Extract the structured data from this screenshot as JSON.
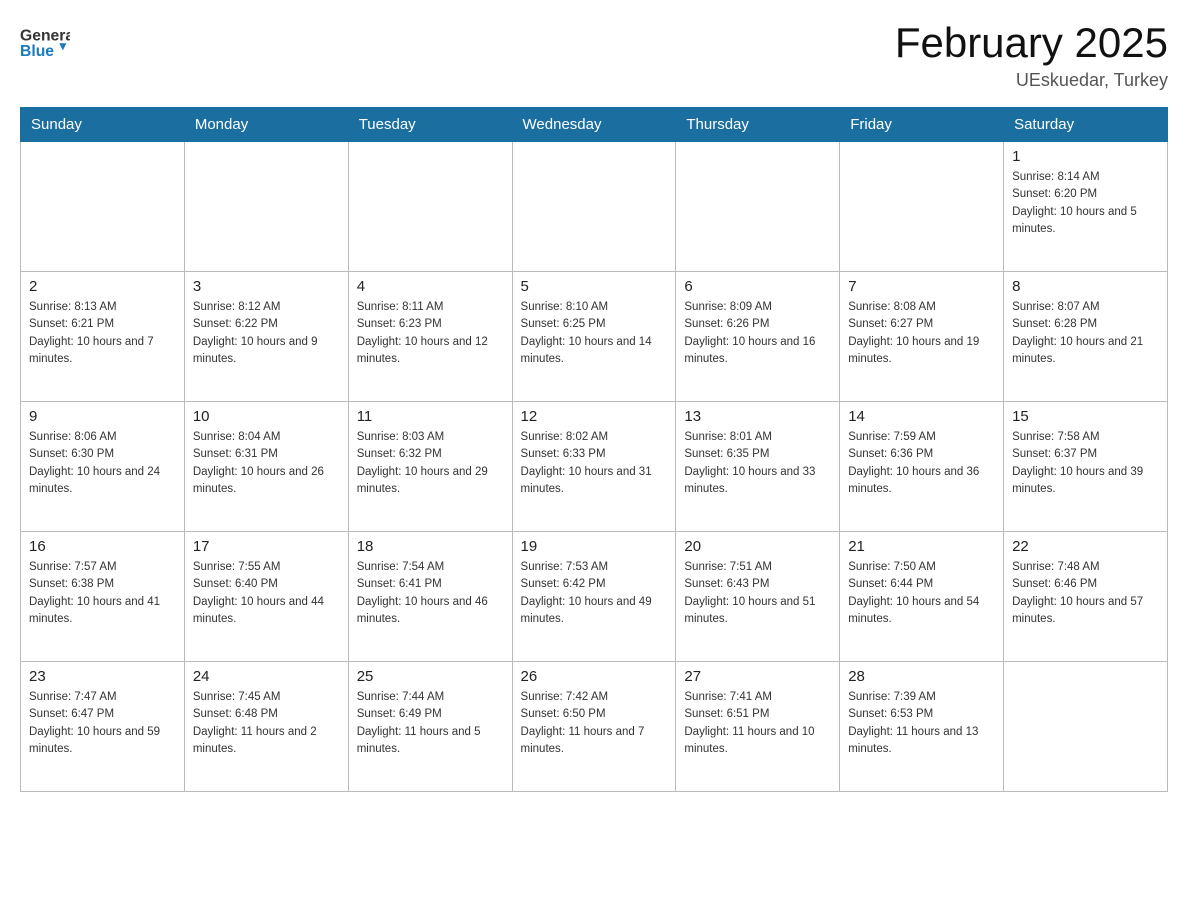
{
  "header": {
    "logo_general": "General",
    "logo_blue": "Blue",
    "month_title": "February 2025",
    "location": "UEskuedar, Turkey"
  },
  "weekdays": [
    "Sunday",
    "Monday",
    "Tuesday",
    "Wednesday",
    "Thursday",
    "Friday",
    "Saturday"
  ],
  "weeks": [
    [
      {
        "day": "",
        "sunrise": "",
        "sunset": "",
        "daylight": ""
      },
      {
        "day": "",
        "sunrise": "",
        "sunset": "",
        "daylight": ""
      },
      {
        "day": "",
        "sunrise": "",
        "sunset": "",
        "daylight": ""
      },
      {
        "day": "",
        "sunrise": "",
        "sunset": "",
        "daylight": ""
      },
      {
        "day": "",
        "sunrise": "",
        "sunset": "",
        "daylight": ""
      },
      {
        "day": "",
        "sunrise": "",
        "sunset": "",
        "daylight": ""
      },
      {
        "day": "1",
        "sunrise": "Sunrise: 8:14 AM",
        "sunset": "Sunset: 6:20 PM",
        "daylight": "Daylight: 10 hours and 5 minutes."
      }
    ],
    [
      {
        "day": "2",
        "sunrise": "Sunrise: 8:13 AM",
        "sunset": "Sunset: 6:21 PM",
        "daylight": "Daylight: 10 hours and 7 minutes."
      },
      {
        "day": "3",
        "sunrise": "Sunrise: 8:12 AM",
        "sunset": "Sunset: 6:22 PM",
        "daylight": "Daylight: 10 hours and 9 minutes."
      },
      {
        "day": "4",
        "sunrise": "Sunrise: 8:11 AM",
        "sunset": "Sunset: 6:23 PM",
        "daylight": "Daylight: 10 hours and 12 minutes."
      },
      {
        "day": "5",
        "sunrise": "Sunrise: 8:10 AM",
        "sunset": "Sunset: 6:25 PM",
        "daylight": "Daylight: 10 hours and 14 minutes."
      },
      {
        "day": "6",
        "sunrise": "Sunrise: 8:09 AM",
        "sunset": "Sunset: 6:26 PM",
        "daylight": "Daylight: 10 hours and 16 minutes."
      },
      {
        "day": "7",
        "sunrise": "Sunrise: 8:08 AM",
        "sunset": "Sunset: 6:27 PM",
        "daylight": "Daylight: 10 hours and 19 minutes."
      },
      {
        "day": "8",
        "sunrise": "Sunrise: 8:07 AM",
        "sunset": "Sunset: 6:28 PM",
        "daylight": "Daylight: 10 hours and 21 minutes."
      }
    ],
    [
      {
        "day": "9",
        "sunrise": "Sunrise: 8:06 AM",
        "sunset": "Sunset: 6:30 PM",
        "daylight": "Daylight: 10 hours and 24 minutes."
      },
      {
        "day": "10",
        "sunrise": "Sunrise: 8:04 AM",
        "sunset": "Sunset: 6:31 PM",
        "daylight": "Daylight: 10 hours and 26 minutes."
      },
      {
        "day": "11",
        "sunrise": "Sunrise: 8:03 AM",
        "sunset": "Sunset: 6:32 PM",
        "daylight": "Daylight: 10 hours and 29 minutes."
      },
      {
        "day": "12",
        "sunrise": "Sunrise: 8:02 AM",
        "sunset": "Sunset: 6:33 PM",
        "daylight": "Daylight: 10 hours and 31 minutes."
      },
      {
        "day": "13",
        "sunrise": "Sunrise: 8:01 AM",
        "sunset": "Sunset: 6:35 PM",
        "daylight": "Daylight: 10 hours and 33 minutes."
      },
      {
        "day": "14",
        "sunrise": "Sunrise: 7:59 AM",
        "sunset": "Sunset: 6:36 PM",
        "daylight": "Daylight: 10 hours and 36 minutes."
      },
      {
        "day": "15",
        "sunrise": "Sunrise: 7:58 AM",
        "sunset": "Sunset: 6:37 PM",
        "daylight": "Daylight: 10 hours and 39 minutes."
      }
    ],
    [
      {
        "day": "16",
        "sunrise": "Sunrise: 7:57 AM",
        "sunset": "Sunset: 6:38 PM",
        "daylight": "Daylight: 10 hours and 41 minutes."
      },
      {
        "day": "17",
        "sunrise": "Sunrise: 7:55 AM",
        "sunset": "Sunset: 6:40 PM",
        "daylight": "Daylight: 10 hours and 44 minutes."
      },
      {
        "day": "18",
        "sunrise": "Sunrise: 7:54 AM",
        "sunset": "Sunset: 6:41 PM",
        "daylight": "Daylight: 10 hours and 46 minutes."
      },
      {
        "day": "19",
        "sunrise": "Sunrise: 7:53 AM",
        "sunset": "Sunset: 6:42 PM",
        "daylight": "Daylight: 10 hours and 49 minutes."
      },
      {
        "day": "20",
        "sunrise": "Sunrise: 7:51 AM",
        "sunset": "Sunset: 6:43 PM",
        "daylight": "Daylight: 10 hours and 51 minutes."
      },
      {
        "day": "21",
        "sunrise": "Sunrise: 7:50 AM",
        "sunset": "Sunset: 6:44 PM",
        "daylight": "Daylight: 10 hours and 54 minutes."
      },
      {
        "day": "22",
        "sunrise": "Sunrise: 7:48 AM",
        "sunset": "Sunset: 6:46 PM",
        "daylight": "Daylight: 10 hours and 57 minutes."
      }
    ],
    [
      {
        "day": "23",
        "sunrise": "Sunrise: 7:47 AM",
        "sunset": "Sunset: 6:47 PM",
        "daylight": "Daylight: 10 hours and 59 minutes."
      },
      {
        "day": "24",
        "sunrise": "Sunrise: 7:45 AM",
        "sunset": "Sunset: 6:48 PM",
        "daylight": "Daylight: 11 hours and 2 minutes."
      },
      {
        "day": "25",
        "sunrise": "Sunrise: 7:44 AM",
        "sunset": "Sunset: 6:49 PM",
        "daylight": "Daylight: 11 hours and 5 minutes."
      },
      {
        "day": "26",
        "sunrise": "Sunrise: 7:42 AM",
        "sunset": "Sunset: 6:50 PM",
        "daylight": "Daylight: 11 hours and 7 minutes."
      },
      {
        "day": "27",
        "sunrise": "Sunrise: 7:41 AM",
        "sunset": "Sunset: 6:51 PM",
        "daylight": "Daylight: 11 hours and 10 minutes."
      },
      {
        "day": "28",
        "sunrise": "Sunrise: 7:39 AM",
        "sunset": "Sunset: 6:53 PM",
        "daylight": "Daylight: 11 hours and 13 minutes."
      },
      {
        "day": "",
        "sunrise": "",
        "sunset": "",
        "daylight": ""
      }
    ]
  ]
}
